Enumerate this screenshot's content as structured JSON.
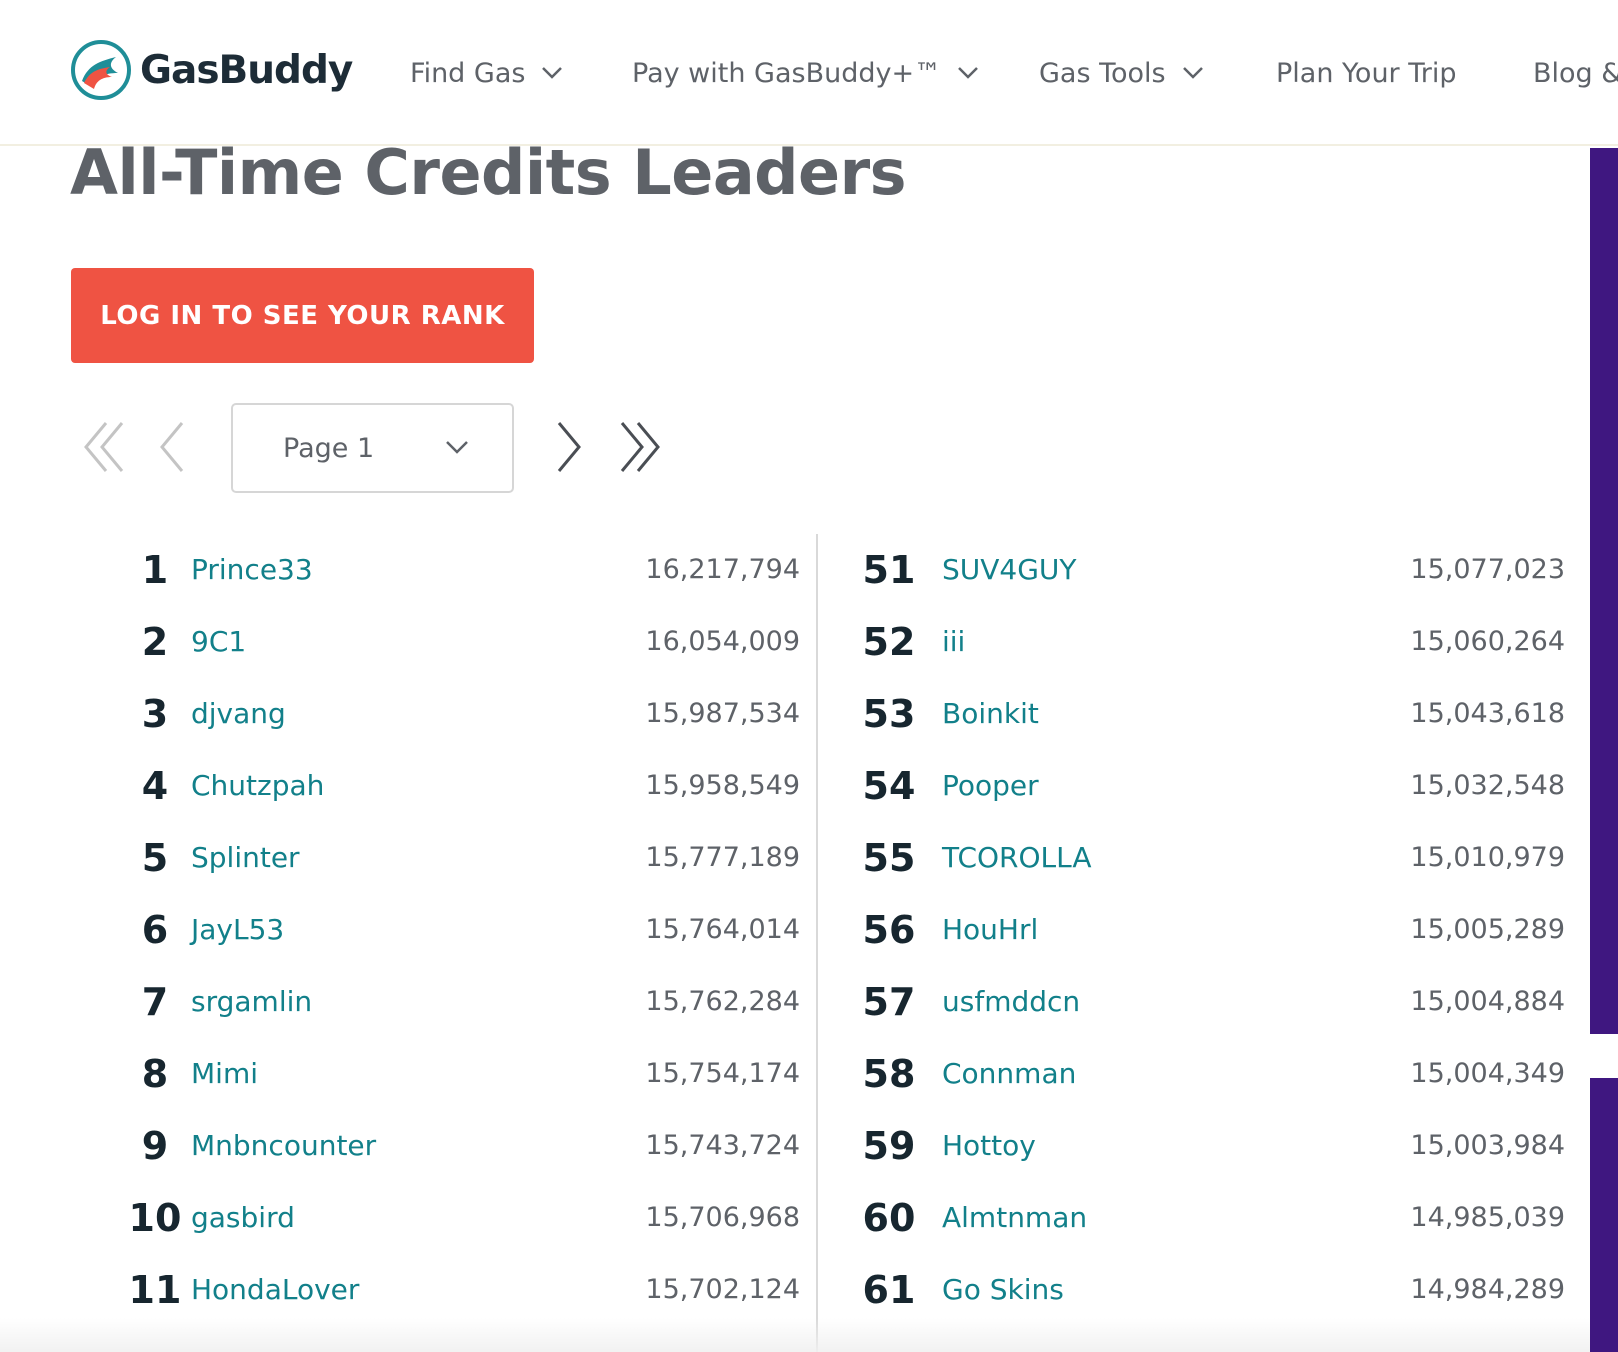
{
  "header": {
    "logo_text": "GasBuddy",
    "nav": [
      {
        "label": "Find Gas",
        "has_dropdown": true
      },
      {
        "label": "Pay with GasBuddy+™",
        "has_dropdown": true
      },
      {
        "label": "Gas Tools",
        "has_dropdown": true
      },
      {
        "label": "Plan Your Trip",
        "has_dropdown": false
      },
      {
        "label": "Blog &",
        "has_dropdown": false
      }
    ]
  },
  "page": {
    "title": "All-Time Credits Leaders",
    "login_button": "LOG IN TO SEE YOUR RANK"
  },
  "pagination": {
    "selected_page": "Page 1",
    "icons": [
      "first-page-icon",
      "previous-page-icon",
      "next-page-icon",
      "last-page-icon"
    ]
  },
  "leaderboard": {
    "left": [
      {
        "rank": "1",
        "user": "Prince33",
        "credits": "16,217,794"
      },
      {
        "rank": "2",
        "user": "9C1",
        "credits": "16,054,009"
      },
      {
        "rank": "3",
        "user": "djvang",
        "credits": "15,987,534"
      },
      {
        "rank": "4",
        "user": "Chutzpah",
        "credits": "15,958,549"
      },
      {
        "rank": "5",
        "user": "Splinter",
        "credits": "15,777,189"
      },
      {
        "rank": "6",
        "user": "JayL53",
        "credits": "15,764,014"
      },
      {
        "rank": "7",
        "user": "srgamlin",
        "credits": "15,762,284"
      },
      {
        "rank": "8",
        "user": "Mimi",
        "credits": "15,754,174"
      },
      {
        "rank": "9",
        "user": "Mnbncounter",
        "credits": "15,743,724"
      },
      {
        "rank": "10",
        "user": "gasbird",
        "credits": "15,706,968"
      },
      {
        "rank": "11",
        "user": "HondaLover",
        "credits": "15,702,124"
      }
    ],
    "right": [
      {
        "rank": "51",
        "user": "SUV4GUY",
        "credits": "15,077,023"
      },
      {
        "rank": "52",
        "user": "iii",
        "credits": "15,060,264"
      },
      {
        "rank": "53",
        "user": "Boinkit",
        "credits": "15,043,618"
      },
      {
        "rank": "54",
        "user": "Pooper",
        "credits": "15,032,548"
      },
      {
        "rank": "55",
        "user": "TCOROLLA",
        "credits": "15,010,979"
      },
      {
        "rank": "56",
        "user": "HouHrl",
        "credits": "15,005,289"
      },
      {
        "rank": "57",
        "user": "usfmddcn",
        "credits": "15,004,884"
      },
      {
        "rank": "58",
        "user": "Connman",
        "credits": "15,004,349"
      },
      {
        "rank": "59",
        "user": "Hottoy",
        "credits": "15,003,984"
      },
      {
        "rank": "60",
        "user": "Almtnman",
        "credits": "14,985,039"
      },
      {
        "rank": "61",
        "user": "Go Skins",
        "credits": "14,984,289"
      }
    ]
  },
  "colors": {
    "brand_red": "#ef5343",
    "username_teal": "#12808a",
    "ad_purple": "#3f1780"
  }
}
